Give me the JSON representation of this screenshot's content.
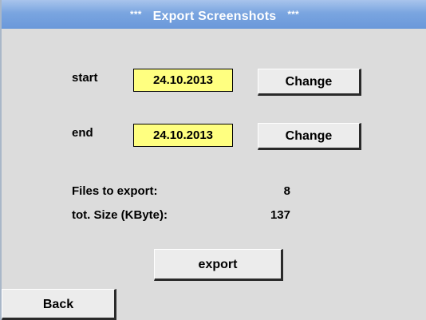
{
  "window": {
    "title_stars_left": "***",
    "title": "Export Screenshots",
    "title_stars_right": "***"
  },
  "start": {
    "label": "start",
    "date": "24.10.2013",
    "change_label": "Change"
  },
  "end": {
    "label": "end",
    "date": "24.10.2013",
    "change_label": "Change"
  },
  "summary": {
    "files_label": "Files to export:",
    "files_value": "8",
    "size_label": "tot. Size (KByte):",
    "size_value": "137"
  },
  "actions": {
    "export_label": "export",
    "back_label": "Back"
  },
  "colors": {
    "title_bar": "#7aa5e0",
    "date_field": "#ffff80",
    "background": "#dcdcdc"
  }
}
